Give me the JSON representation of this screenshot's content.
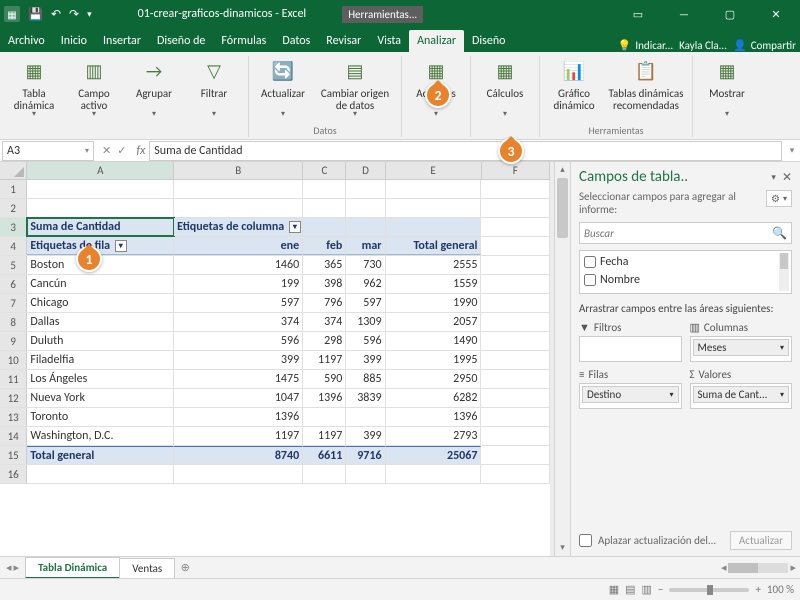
{
  "title": {
    "filename": "01-crear-graficos-dinamicos  -  Excel",
    "tooltab": "Herramientas..."
  },
  "tabs": [
    "Archivo",
    "Inicio",
    "Insertar",
    "Diseño de",
    "Fórmulas",
    "Datos",
    "Revisar",
    "Vista",
    "Analizar",
    "Diseño"
  ],
  "activeTab": 8,
  "tell": "Indicar...",
  "user": "Kayla Cla...",
  "share": "Compartir",
  "ribbon": {
    "g1": {
      "btns": [
        "Tabla dinámica",
        "Campo activo",
        "Agrupar",
        "Filtrar"
      ],
      "label": ""
    },
    "g2": {
      "btns": [
        "Actualizar",
        "Cambiar origen de datos"
      ],
      "label": "Datos"
    },
    "g3": {
      "btns": [
        "Acciones"
      ],
      "label": ""
    },
    "g4": {
      "btns": [
        "Cálculos"
      ],
      "label": ""
    },
    "g5": {
      "btns": [
        "Gráfico dinámico",
        "Tablas dinámicas recomendadas"
      ],
      "label": "Herramientas"
    },
    "g6": {
      "btns": [
        "Mostrar"
      ],
      "label": ""
    }
  },
  "callouts": {
    "c1": "1",
    "c2": "2",
    "c3": "3"
  },
  "fx": {
    "cell": "A3",
    "formula": "Suma de Cantidad"
  },
  "colWidths": {
    "A": 150,
    "B": 132,
    "C": 44,
    "D": 40,
    "E": 98,
    "F": 70
  },
  "headers": [
    "A",
    "B",
    "C",
    "D",
    "E",
    "F"
  ],
  "pivot": {
    "a3": "Suma de Cantidad",
    "b3": "Etiquetas de columna",
    "a4": "Etiquetas de fila",
    "months": [
      "ene",
      "feb",
      "mar"
    ],
    "tg": "Total general",
    "rows": [
      {
        "city": "Boston",
        "v": [
          1460,
          365,
          730
        ],
        "t": 2555
      },
      {
        "city": "Cancún",
        "v": [
          199,
          398,
          962
        ],
        "t": 1559
      },
      {
        "city": "Chicago",
        "v": [
          597,
          796,
          597
        ],
        "t": 1990
      },
      {
        "city": "Dallas",
        "v": [
          374,
          374,
          1309
        ],
        "t": 2057
      },
      {
        "city": "Duluth",
        "v": [
          596,
          298,
          596
        ],
        "t": 1490
      },
      {
        "city": "Filadelfia",
        "v": [
          399,
          1197,
          399
        ],
        "t": 1995
      },
      {
        "city": "Los Ángeles",
        "v": [
          1475,
          590,
          885
        ],
        "t": 2950
      },
      {
        "city": "Nueva York",
        "v": [
          1047,
          1396,
          3839
        ],
        "t": 6282
      },
      {
        "city": "Toronto",
        "v": [
          1396,
          "",
          ""
        ],
        "t": 1396
      },
      {
        "city": "Washington, D.C.",
        "v": [
          1197,
          1197,
          399
        ],
        "t": 2793
      }
    ],
    "totals": {
      "label": "Total general",
      "v": [
        8740,
        6611,
        9716
      ],
      "t": 25067
    }
  },
  "sheets": {
    "active": "Tabla Dinámica",
    "other": "Ventas"
  },
  "status": {
    "mode": "",
    "zoom": "100 %"
  },
  "pane": {
    "title": "Campos de tabla..",
    "sub": "Seleccionar campos para agregar al informe:",
    "search": "Buscar",
    "fields": [
      "Fecha",
      "Nombre"
    ],
    "drag": "Arrastrar campos entre las áreas siguientes:",
    "areas": {
      "filters": "Filtros",
      "cols": "Columnas",
      "rows": "Filas",
      "vals": "Valores"
    },
    "colChip": "Meses",
    "rowChip": "Destino",
    "valChip": "Suma de Cant...",
    "defer": "Aplazar actualización del...",
    "update": "Actualizar"
  }
}
